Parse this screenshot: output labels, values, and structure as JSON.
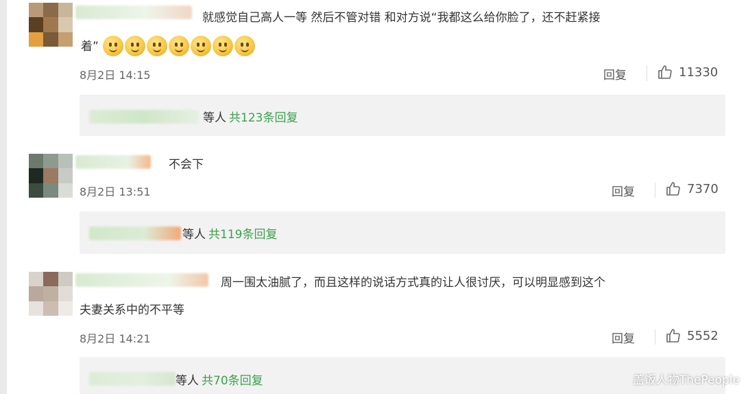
{
  "comments": [
    {
      "text_line1": "就感觉自己高人一等 然后不管对错 和对方说“我都这么给你脸了，还不赶紧接",
      "text_line2": "着”",
      "emoji_count": 7,
      "time": "8月2日 14:15",
      "reply_label": "回复",
      "likes": "11330",
      "replies_prefix": "等人",
      "replies_count": "共123条回复"
    },
    {
      "text_line1": "不会下",
      "time": "8月2日 13:51",
      "reply_label": "回复",
      "likes": "7370",
      "replies_prefix": "等人",
      "replies_count": "共119条回复"
    },
    {
      "text_line1": "周一围太油腻了，而且这样的说话方式真的让人很讨厌，可以明显感到这个",
      "text_line2": "夫妻关系中的不平等",
      "time": "8月2日 14:21",
      "reply_label": "回复",
      "likes": "5552",
      "replies_prefix": "等人",
      "replies_count": "共70条回复"
    }
  ],
  "watermark": "盖饭人物ThePeople",
  "colors": {
    "reply_green": "#3aa14e",
    "reply_bg": "#f2f2f2",
    "meta_gray": "#666666"
  },
  "icons": [
    "thumbs-up-icon",
    "emoji-icon"
  ]
}
